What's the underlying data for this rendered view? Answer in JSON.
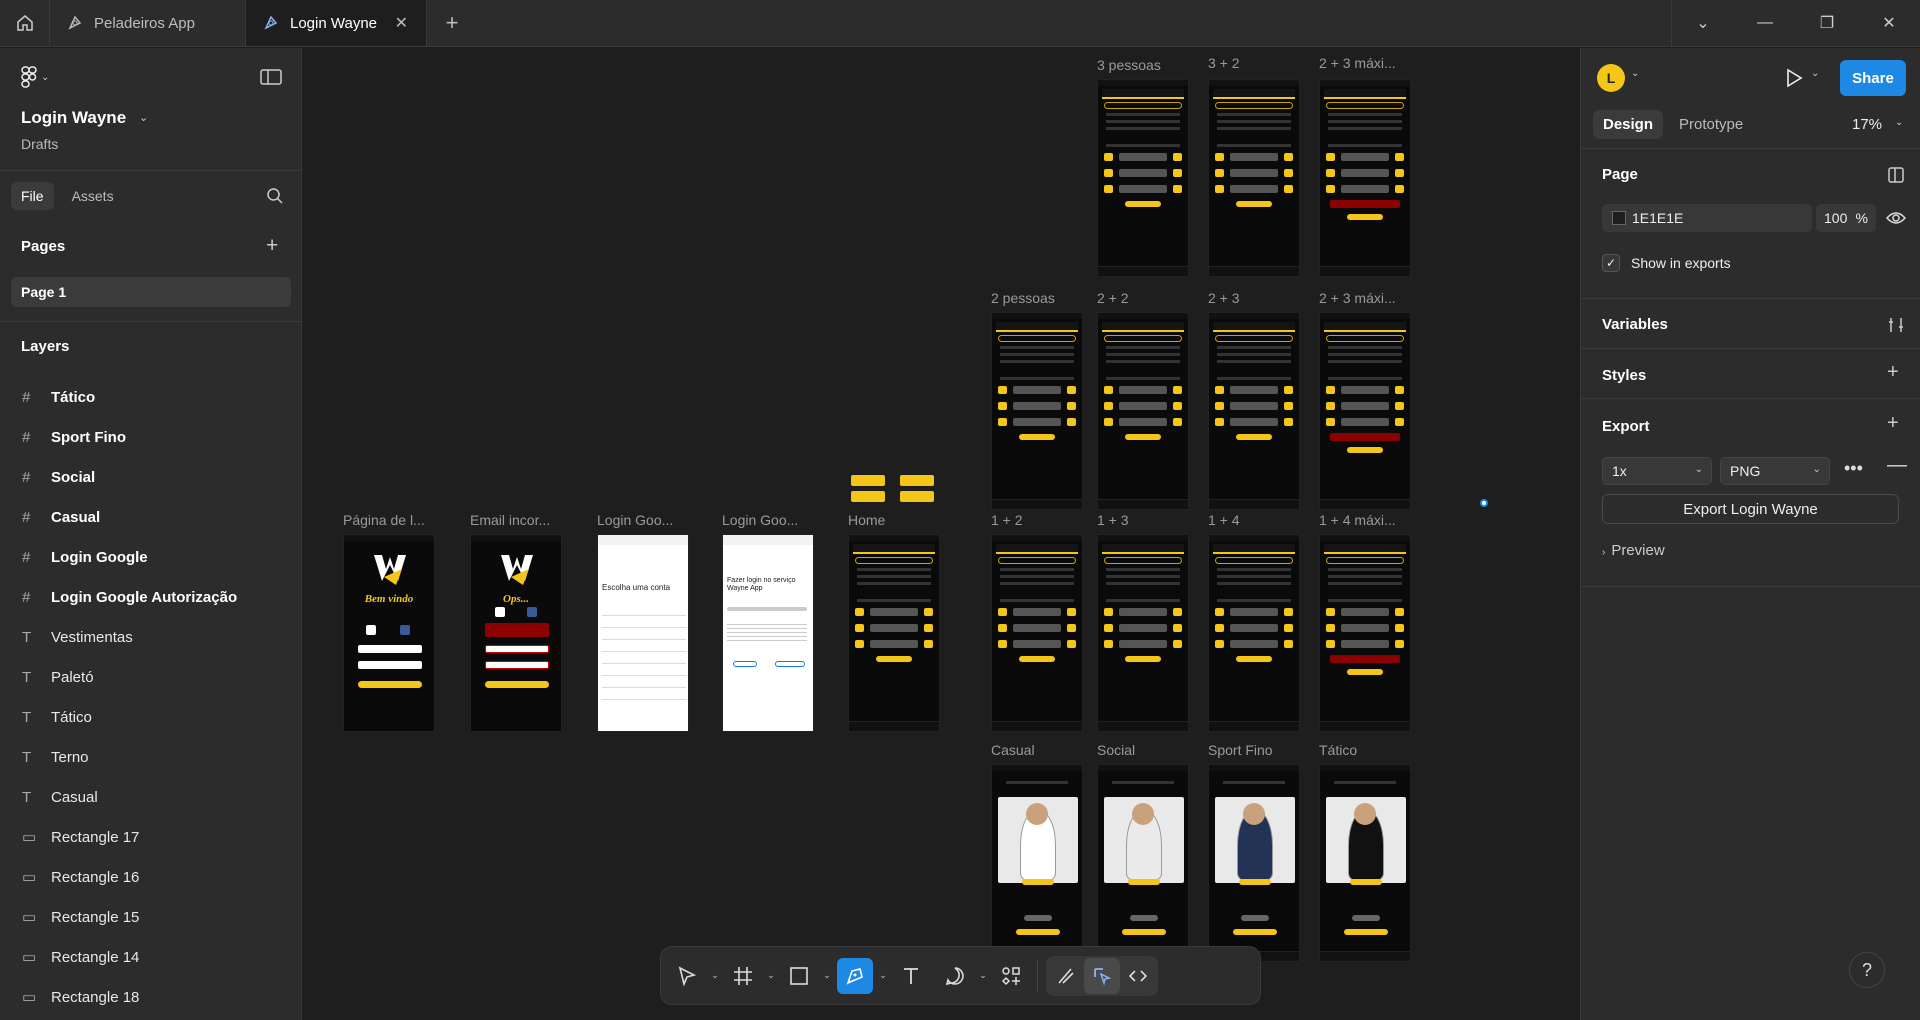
{
  "tabs": {
    "t1": "Peladeiros App",
    "t2": "Login Wayne"
  },
  "file": {
    "title": "Login Wayne",
    "location": "Drafts"
  },
  "left_tabs": {
    "file": "File",
    "assets": "Assets"
  },
  "pages": {
    "header": "Pages",
    "items": [
      "Page 1"
    ]
  },
  "layers": {
    "header": "Layers",
    "items": [
      {
        "icon": "#",
        "label": "Tático",
        "bold": true
      },
      {
        "icon": "#",
        "label": "Sport Fino",
        "bold": true
      },
      {
        "icon": "#",
        "label": "Social",
        "bold": true
      },
      {
        "icon": "#",
        "label": "Casual",
        "bold": true
      },
      {
        "icon": "#",
        "label": "Login Google",
        "bold": true
      },
      {
        "icon": "#",
        "label": "Login Google Autorização",
        "bold": true
      },
      {
        "icon": "T",
        "label": "Vestimentas",
        "bold": false
      },
      {
        "icon": "T",
        "label": "Paletó",
        "bold": false
      },
      {
        "icon": "T",
        "label": "Tático",
        "bold": false
      },
      {
        "icon": "T",
        "label": "Terno",
        "bold": false
      },
      {
        "icon": "T",
        "label": "Casual",
        "bold": false
      },
      {
        "icon": "▭",
        "label": "Rectangle 17",
        "bold": false
      },
      {
        "icon": "▭",
        "label": "Rectangle 16",
        "bold": false
      },
      {
        "icon": "▭",
        "label": "Rectangle 15",
        "bold": false
      },
      {
        "icon": "▭",
        "label": "Rectangle 14",
        "bold": false
      },
      {
        "icon": "▭",
        "label": "Rectangle 18",
        "bold": false
      }
    ]
  },
  "canvas": {
    "frames": {
      "p3": "3 pessoas",
      "f32": "3 + 2",
      "f23m_top": "2 + 3 máxi...",
      "p2": "2 pessoas",
      "f22": "2 + 2",
      "f23": "2 + 3",
      "f23m": "2 + 3 máxi...",
      "f12": "1 + 2",
      "f13": "1 + 3",
      "f14": "1 + 4",
      "f14m": "1 + 4 máxi...",
      "casual": "Casual",
      "social": "Social",
      "sportfino": "Sport Fino",
      "tatico": "Tático",
      "pagina": "Página de l...",
      "email": "Email incor...",
      "lg1": "Login Goo...",
      "lg2": "Login Goo...",
      "home": "Home"
    },
    "phone_text": {
      "bemvindo": "Bem vindo",
      "ops": "Ops...",
      "google_choose": "Escolha uma conta",
      "google_login": "Fazer login no serviço Wayne App"
    }
  },
  "right": {
    "avatar": "L",
    "share": "Share",
    "tabs": {
      "design": "Design",
      "prototype": "Prototype"
    },
    "zoom": "17%",
    "page_header": "Page",
    "page_color": "1E1E1E",
    "opacity": "100",
    "opacity_unit": "%",
    "show_exports": "Show in exports",
    "variables": "Variables",
    "styles": "Styles",
    "export": "Export",
    "scale": "1x",
    "format": "PNG",
    "export_btn": "Export Login Wayne",
    "preview": "Preview"
  },
  "help": "?",
  "colors": {
    "accent": "#1e88e5",
    "brand_yellow": "#f5c518",
    "error_red": "#8b0000"
  }
}
